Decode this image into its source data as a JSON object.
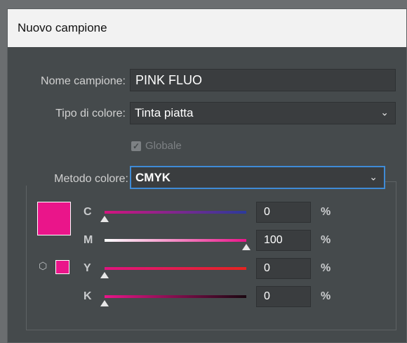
{
  "dialog": {
    "title": "Nuovo campione",
    "name_label": "Nome campione:",
    "name_value": "PINK FLUO",
    "type_label": "Tipo di colore:",
    "type_value": "Tinta piatta",
    "global_label": "Globale",
    "global_checked": true,
    "mode_label": "Metodo colore:",
    "mode_value": "CMYK",
    "swatch_color": "#ea158a",
    "channels": [
      {
        "label": "C",
        "value": "0",
        "fraction": 0,
        "unit": "%",
        "gradient": [
          "#d4147f",
          "#2b3a9c"
        ]
      },
      {
        "label": "M",
        "value": "100",
        "fraction": 1,
        "unit": "%",
        "gradient": [
          "#ffffff",
          "#ea158a"
        ]
      },
      {
        "label": "Y",
        "value": "0",
        "fraction": 0,
        "unit": "%",
        "gradient": [
          "#e0147f",
          "#e52420"
        ]
      },
      {
        "label": "K",
        "value": "0",
        "fraction": 0,
        "unit": "%",
        "gradient": [
          "#ea158a",
          "#1a0710"
        ]
      }
    ]
  }
}
